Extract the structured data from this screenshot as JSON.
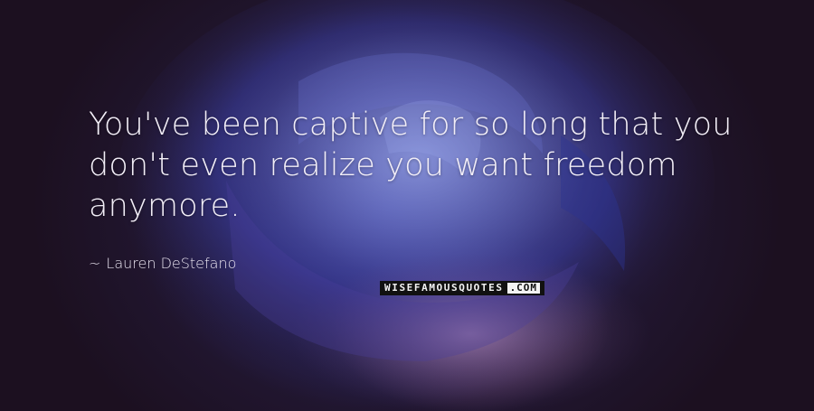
{
  "quote": {
    "text": "You've been captive for so long that you don't even realize you want freedom anymore.",
    "author": "Lauren DeStefano",
    "author_dash": "~"
  },
  "watermark": {
    "main": "WISEFAMOUSQUOTES",
    "suffix": ".COM"
  },
  "colors": {
    "text": "#f2eef7",
    "background": "#1c1020",
    "petal_blue": "#3a40a8",
    "petal_pink": "#a56fa8"
  }
}
